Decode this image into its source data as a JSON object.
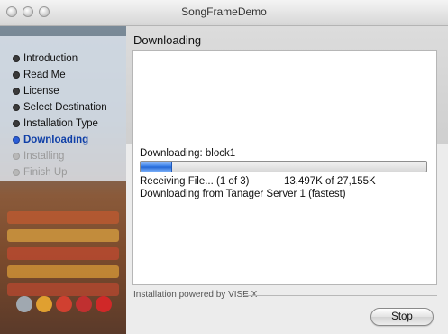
{
  "window": {
    "title": "SongFrameDemo"
  },
  "panel_title": "Downloading",
  "steps": [
    {
      "label": "Introduction",
      "state": "done"
    },
    {
      "label": "Read Me",
      "state": "done"
    },
    {
      "label": "License",
      "state": "done"
    },
    {
      "label": "Select Destination",
      "state": "done"
    },
    {
      "label": "Installation Type",
      "state": "done"
    },
    {
      "label": "Downloading",
      "state": "current"
    },
    {
      "label": "Installing",
      "state": "future"
    },
    {
      "label": "Finish Up",
      "state": "future"
    }
  ],
  "download": {
    "status_label": "Downloading:   block1",
    "progress_fraction": 0.11,
    "receiving": "Receiving File... (1 of 3)",
    "kb": "13,497K of 27,155K",
    "server": "Downloading from Tanager Server 1 (fastest)"
  },
  "footer": {
    "credit": "Installation powered by VISE X"
  },
  "buttons": {
    "stop": "Stop"
  },
  "colors": {
    "accent": "#2a5ed8",
    "progress": "#3a7fe8"
  }
}
